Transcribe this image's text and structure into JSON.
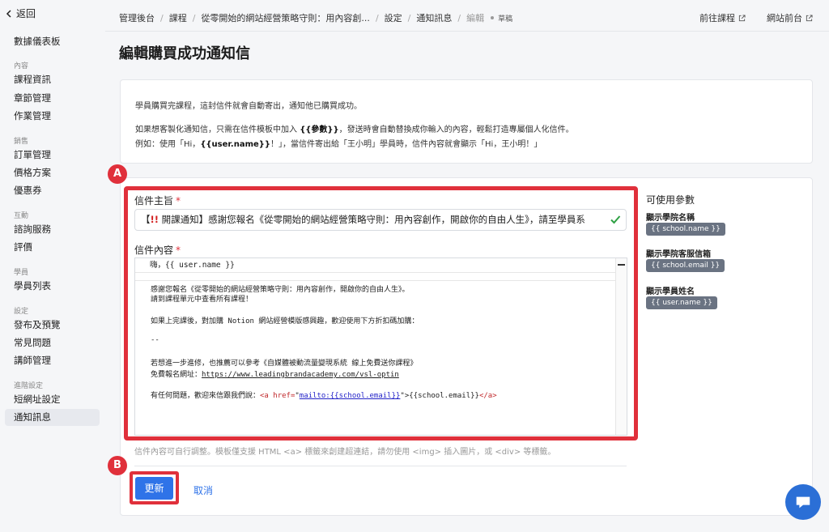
{
  "sidebar": {
    "back_label": "返回",
    "dashboard": "數據儀表板",
    "groups": {
      "content": "內容",
      "sales": "銷售",
      "interaction": "互動",
      "students": "學員",
      "settings": "設定",
      "advanced": "進階設定"
    },
    "items": {
      "course_info": "課程資訊",
      "chapters": "章節管理",
      "assignments": "作業管理",
      "orders": "訂單管理",
      "pricing": "價格方案",
      "coupons": "優惠券",
      "consult": "諮詢服務",
      "reviews": "評價",
      "student_list": "學員列表",
      "publish": "發布及預覽",
      "faq": "常見問題",
      "instructors": "講師管理",
      "short_url": "短網址設定",
      "notifications": "通知訊息"
    }
  },
  "breadcrumb": {
    "admin": "管理後台",
    "courses": "課程",
    "course_name": "從零開始的網站經營策略守則：用內容創...",
    "settings": "設定",
    "notifications": "通知訊息",
    "edit": "編輯",
    "draft": "草稿"
  },
  "header": {
    "goto_course": "前往課程",
    "site_front": "網站前台"
  },
  "page_title": "編輯購買成功通知信",
  "info": {
    "line1": "學員購買完課程，這封信件就會自動寄出，通知他已購買成功。",
    "line2_a": "如果想客製化通知信，只需在信件模板中加入 ",
    "line2_b": "{{參數}}",
    "line2_c": "，發送時會自動替換成你輸入的內容，輕鬆打造專屬個人化信件。",
    "line3_a": "例如：使用「Hi，",
    "line3_b": "{{user.name}}",
    "line3_c": "！」，當信件寄出給「王小明」學員時，信件內容就會顯示「Hi，王小明！」"
  },
  "markers": {
    "a": "A",
    "b": "B"
  },
  "form": {
    "subject_label": "信件主旨",
    "subject_req": "*",
    "subject_prefix": "【",
    "subject_alert": "!!",
    "subject_rest": " 開課通知】感謝您報名《從零開始的網站經營策略守則：用內容創作，開啟你的自由人生》，請至學員系",
    "content_label": "信件內容",
    "content_req": "*",
    "editor_first_line": "嗨，{{ user.name }}",
    "code": {
      "l1": "感謝您報名《從零開始的網站經營策略守則：用內容創作，開啟你的自由人生》。",
      "l2": "請到課程單元中查看所有課程！",
      "l3": "如果上完課後，對加購 Notion 網站經營模版感興趣，歡迎使用下方折扣碼加購：",
      "l4": "--",
      "l5": "若想進一步進修，也推薦可以參考《自媒體被動流量變現系統 線上免費送你課程》",
      "l6_a": "免費報名網址：",
      "l6_b": "https://www.leadingbrandacademy.com/vsl-optin",
      "l7_a": "有任何問題，歡迎來信跟我們說：",
      "l7_tag_open": "<a ",
      "l7_attr": "href=",
      "l7_q1": "\"",
      "l7_href": "mailto:{{school.email}}",
      "l7_q2": "\">",
      "l7_text": "{{school.email}}",
      "l7_tag_close": "</a>"
    },
    "hint": "信件內容可自行調整。模板僅支援 HTML <a> 標籤來創建超連結，請勿使用 <img> 插入圖片，或 <div> 等標籤。",
    "update_button": "更新",
    "cancel_button": "取消"
  },
  "params": {
    "title": "可使用參數",
    "items": [
      {
        "label": "顯示學院名稱",
        "tag": "{{ school.name }}"
      },
      {
        "label": "顯示學院客服信箱",
        "tag": "{{ school.email }}"
      },
      {
        "label": "顯示學員姓名",
        "tag": "{{ user.name }}"
      }
    ]
  },
  "colors": {
    "accent": "#2f73e8",
    "highlight": "#e0303b",
    "success": "#2ea043"
  }
}
